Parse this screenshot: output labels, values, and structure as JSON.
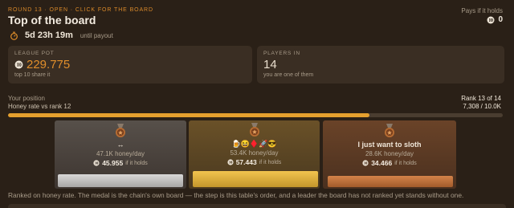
{
  "header": {
    "round_label": "ROUND 13 · OPEN · CLICK FOR THE BOARD",
    "title": "Top of the board",
    "timer_value": "5d 23h 19m",
    "timer_note": "until payout",
    "pays_label": "Pays if it holds",
    "pays_value": "0"
  },
  "cards": {
    "pot": {
      "label": "LEAGUE POT",
      "value": "229.775",
      "sub": "top 10 share it"
    },
    "players": {
      "label": "PLAYERS IN",
      "value": "14",
      "sub": "you are one of them"
    }
  },
  "position": {
    "label": "Your position",
    "sub": "Honey rate vs rank 12",
    "rank": "Rank 13 of 14",
    "progress_text": "7,308 / 10.0K",
    "progress_fraction": 0.7308
  },
  "podium": [
    {
      "place": "silver",
      "name": "↔",
      "rate": "47.1K honey/day",
      "hold_value": "45.955",
      "hold_note": "if it holds"
    },
    {
      "place": "gold",
      "name": "🍺😆♦️🚀😎",
      "rate": "53.4K honey/day",
      "hold_value": "57.443",
      "hold_note": "if it holds"
    },
    {
      "place": "bronze",
      "name": "I just want to sloth",
      "rate": "28.6K honey/day",
      "hold_value": "34.466",
      "hold_note": "if it holds"
    }
  ],
  "footnote": "Ranked on honey rate. The medal is the chain's own board — the step is this table's order, and a leader the board has not ranked yet stands without one.",
  "colors": {
    "accent": "#e08e2b",
    "gold": "#f2c44f",
    "silver": "#d9d8d7",
    "bronze": "#d3834a"
  },
  "icons": {
    "timer": "stopwatch-icon",
    "coin": "honey-coin-icon",
    "medal": "medal-icon"
  }
}
